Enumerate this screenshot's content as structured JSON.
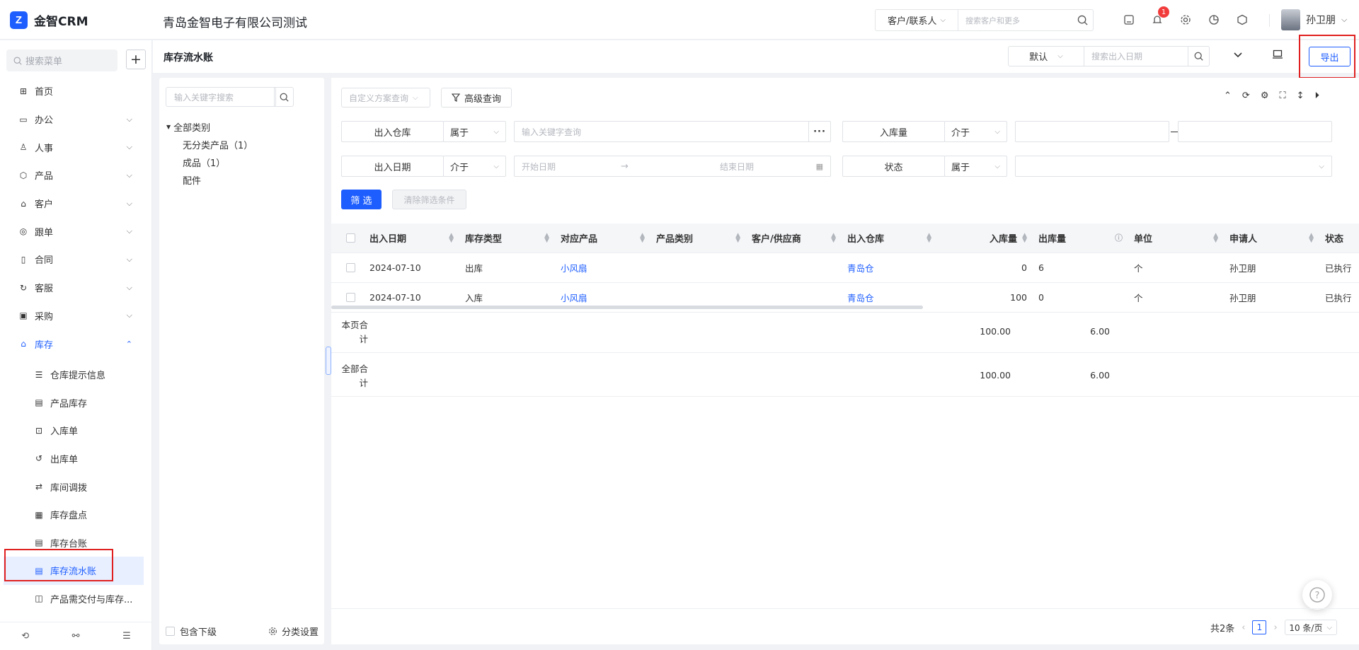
{
  "app": {
    "logo_text": "金智CRM",
    "company": "青岛金智电子有限公司测试"
  },
  "global_search": {
    "scope": "客户/联系人",
    "placeholder": "搜索客户和更多"
  },
  "notifications": {
    "count": "1"
  },
  "user": {
    "name": "孙卫朋"
  },
  "sidebar": {
    "search_placeholder": "搜索菜单",
    "items": [
      {
        "label": "首页",
        "icon": "home-icon"
      },
      {
        "label": "办公",
        "icon": "monitor-icon"
      },
      {
        "label": "人事",
        "icon": "people-icon"
      },
      {
        "label": "产品",
        "icon": "box-icon"
      },
      {
        "label": "客户",
        "icon": "customer-icon"
      },
      {
        "label": "跟单",
        "icon": "track-icon"
      },
      {
        "label": "合同",
        "icon": "contract-icon"
      },
      {
        "label": "客服",
        "icon": "service-icon"
      },
      {
        "label": "采购",
        "icon": "purchase-icon"
      },
      {
        "label": "库存",
        "icon": "warehouse-icon"
      }
    ],
    "sub_items": [
      {
        "label": "仓库提示信息"
      },
      {
        "label": "产品库存"
      },
      {
        "label": "入库单"
      },
      {
        "label": "出库单"
      },
      {
        "label": "库间调拨"
      },
      {
        "label": "库存盘点"
      },
      {
        "label": "库存台账"
      },
      {
        "label": "库存流水账"
      },
      {
        "label": "产品需交付与库存..."
      }
    ]
  },
  "page": {
    "title": "库存流水账",
    "view_select": "默认",
    "search_placeholder": "搜索出入日期",
    "export_label": "导出"
  },
  "category_panel": {
    "search_placeholder": "输入关键字搜索",
    "root": "全部类别",
    "children": [
      "无分类产品（1）",
      "成品（1）",
      "配件"
    ],
    "include_children": "包含下级",
    "settings": "分类设置"
  },
  "filters": {
    "scheme_placeholder": "自定义方案查询",
    "advanced": "高级查询",
    "warehouse_label": "出入仓库",
    "warehouse_op": "属于",
    "warehouse_placeholder": "输入关键字查询",
    "in_qty_label": "入库量",
    "in_qty_op": "介于",
    "date_label": "出入日期",
    "date_op": "介于",
    "date_start": "开始日期",
    "date_end": "结束日期",
    "status_label": "状态",
    "status_op": "属于",
    "apply": "筛 选",
    "clear": "清除筛选条件"
  },
  "table": {
    "columns": [
      "出入日期",
      "库存类型",
      "对应产品",
      "产品类别",
      "客户/供应商",
      "出入仓库",
      "入库量",
      "出库量",
      "单位",
      "申请人",
      "状态"
    ],
    "rows": [
      [
        "2024-07-10",
        "出库",
        "小风扇",
        "",
        "",
        "青岛仓",
        "0",
        "6",
        "个",
        "孙卫朋",
        "已执行"
      ],
      [
        "2024-07-10",
        "入库",
        "小风扇",
        "",
        "",
        "青岛仓",
        "100",
        "0",
        "个",
        "孙卫朋",
        "已执行"
      ]
    ],
    "page_total_label": "本页合计",
    "page_total_in": "100.00",
    "page_total_out": "6.00",
    "all_total_label": "全部合计",
    "all_total_in": "100.00",
    "all_total_out": "6.00"
  },
  "pager": {
    "total": "共2条",
    "current": "1",
    "size": "10 条/页"
  },
  "colors": {
    "primary": "#1e5eff",
    "highlight": "#e02020",
    "badge": "#f23c3c"
  }
}
